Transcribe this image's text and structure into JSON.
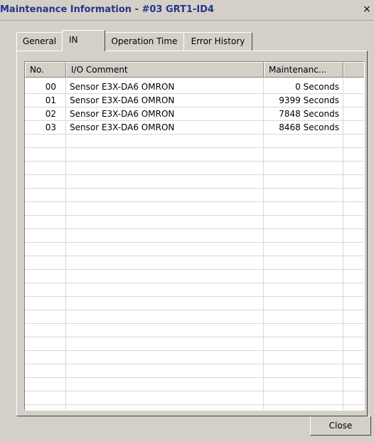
{
  "window": {
    "title": "Maintenance Information - #03 GRT1-ID4",
    "close_glyph": "×"
  },
  "tabs": [
    {
      "label": "General",
      "active": false
    },
    {
      "label": "IN",
      "active": true
    },
    {
      "label": "Operation Time",
      "active": false
    },
    {
      "label": "Error History",
      "active": false
    }
  ],
  "table": {
    "columns": [
      "No.",
      "I/O Comment",
      "Maintenanc..."
    ],
    "rows": [
      {
        "no": "00",
        "comment": "Sensor E3X-DA6 OMRON",
        "time": "0 Seconds"
      },
      {
        "no": "01",
        "comment": "Sensor E3X-DA6 OMRON",
        "time": "9399 Seconds"
      },
      {
        "no": "02",
        "comment": "Sensor E3X-DA6 OMRON",
        "time": "7848 Seconds"
      },
      {
        "no": "03",
        "comment": "Sensor E3X-DA6 OMRON",
        "time": "8468 Seconds"
      }
    ]
  },
  "buttons": {
    "close_label": "Close"
  },
  "colors": {
    "title_text": "#23368a",
    "face": "#d4d0c8",
    "grid": "#d8d8d8"
  }
}
